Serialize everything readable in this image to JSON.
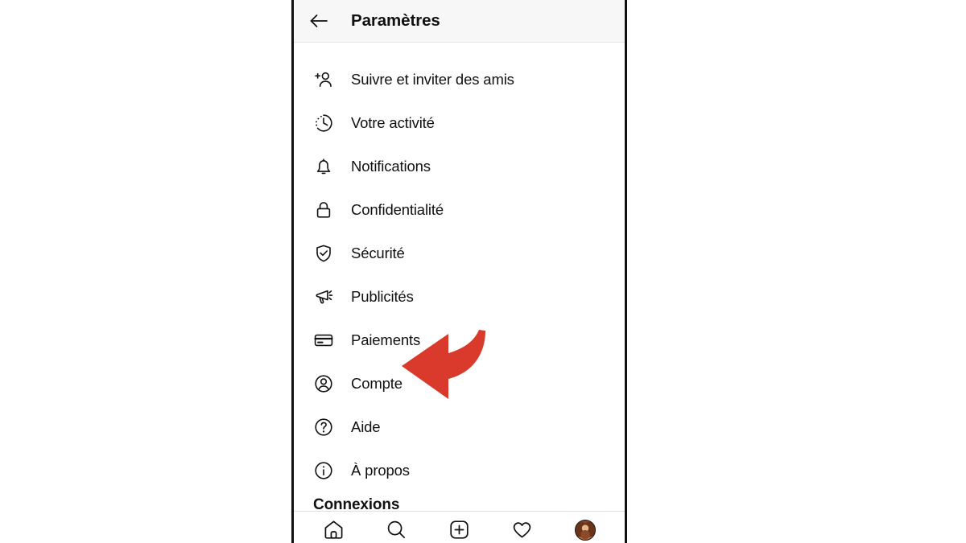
{
  "header": {
    "back_icon": "back-arrow-icon",
    "title": "Paramètres"
  },
  "menu": {
    "items": [
      {
        "icon": "person-add-icon",
        "label": "Suivre et inviter des amis"
      },
      {
        "icon": "activity-clock-icon",
        "label": "Votre activité"
      },
      {
        "icon": "bell-icon",
        "label": "Notifications"
      },
      {
        "icon": "lock-icon",
        "label": "Confidentialité"
      },
      {
        "icon": "shield-check-icon",
        "label": "Sécurité"
      },
      {
        "icon": "megaphone-icon",
        "label": "Publicités"
      },
      {
        "icon": "credit-card-icon",
        "label": "Paiements"
      },
      {
        "icon": "account-circle-icon",
        "label": "Compte"
      },
      {
        "icon": "help-circle-icon",
        "label": "Aide"
      },
      {
        "icon": "info-circle-icon",
        "label": "À propos"
      }
    ],
    "section_heading": "Connexions"
  },
  "bottom_nav": {
    "items": [
      {
        "icon": "home-icon",
        "label": "Accueil"
      },
      {
        "icon": "search-icon",
        "label": "Recherche"
      },
      {
        "icon": "add-post-icon",
        "label": "Créer"
      },
      {
        "icon": "heart-icon",
        "label": "Notifications"
      },
      {
        "icon": "profile-avatar-icon",
        "label": "Profil"
      }
    ]
  },
  "annotation": {
    "arrow_icon": "curved-red-arrow-pointing-left",
    "arrow_color": "#d93a2b",
    "points_at": "Compte"
  },
  "colors": {
    "page_background": "#ffffff",
    "phone_border": "#111111",
    "header_background": "#f7f7f7",
    "text": "#111111",
    "accent_red": "#d93a2b"
  }
}
